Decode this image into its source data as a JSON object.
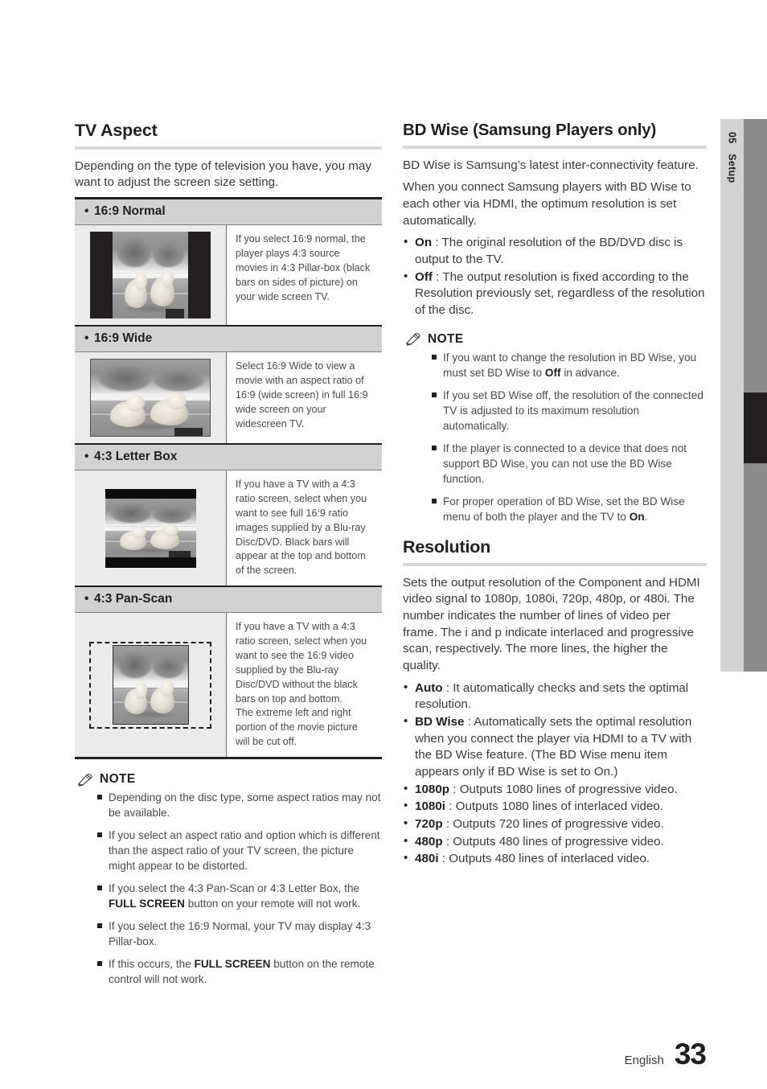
{
  "side_tab": {
    "chapter_number": "05",
    "chapter_label": "Setup"
  },
  "footer": {
    "language": "English",
    "page_number": "33"
  },
  "left_column": {
    "title": "TV Aspect",
    "intro": "Depending on the type of television you have, you may want to adjust the screen size setting.",
    "aspect_rows": [
      {
        "label": "16:9 Normal",
        "description": "If you select 16:9 normal, the player plays 4:3 source movies in 4:3 Pillar-box (black bars on sides of picture) on your wide screen TV.",
        "picture": "pillarbox-4-3-in-16-9-thumbnail"
      },
      {
        "label": "16:9 Wide",
        "description": "Select 16:9 Wide to view a movie with an aspect ratio of 16:9 (wide screen) in full 16:9 wide screen on your widescreen TV.",
        "picture": "full-16-9-widescreen-thumbnail"
      },
      {
        "label": "4:3 Letter Box",
        "description": "If you have a TV with a 4:3 ratio screen, select when you want to see full 16:9 ratio images supplied by a Blu-ray Disc/DVD. Black bars will appear at the top and bottom of the screen.",
        "picture": "letterbox-16-9-in-4-3-thumbnail"
      },
      {
        "label": "4:3 Pan-Scan",
        "description_parts": [
          "If you have a TV with a 4:3 ratio screen, select when you want to see the 16:9 video supplied by the Blu-ray Disc/DVD without the black bars on top and bottom.",
          "The extreme left and right portion of the movie picture will be cut off."
        ],
        "picture": "pan-scan-crop-thumbnail"
      }
    ],
    "note": {
      "label": "NOTE",
      "items": [
        [
          {
            "text": "Depending on the disc type, some aspect ratios may not be available.",
            "bold": false
          }
        ],
        [
          {
            "text": "If you select an aspect ratio and option which is different than the aspect ratio of your TV screen, the picture might appear to be distorted.",
            "bold": false
          }
        ],
        [
          {
            "text": "If you select the 4:3 Pan-Scan or 4:3 Letter Box, the ",
            "bold": false
          },
          {
            "text": "FULL SCREEN",
            "bold": true
          },
          {
            "text": " button on your remote will not work.",
            "bold": false
          }
        ],
        [
          {
            "text": "If you select the 16:9 Normal, your TV may display 4:3 Pillar-box.",
            "bold": false
          }
        ],
        [
          {
            "text": "If this occurs, the ",
            "bold": false
          },
          {
            "text": "FULL SCREEN",
            "bold": true
          },
          {
            "text": " button on the remote control will not work.",
            "bold": false
          }
        ]
      ]
    }
  },
  "right_column": {
    "bd_wise": {
      "title": "BD Wise (Samsung Players only)",
      "paragraphs": [
        "BD Wise is Samsung’s latest inter-connectivity feature.",
        "When you connect Samsung players with BD Wise to each other via HDMI, the optimum resolution is set automatically."
      ],
      "options": [
        {
          "term": "On",
          "desc": " : The original resolution of the BD/DVD disc is output to the TV."
        },
        {
          "term": "Off",
          "desc": " : The output resolution is fixed according to the Resolution previously set, regardless of the resolution of the disc."
        }
      ],
      "note": {
        "label": "NOTE",
        "items": [
          [
            {
              "text": "If you want to change the resolution in BD Wise, you must set BD Wise to ",
              "bold": false
            },
            {
              "text": "Off",
              "bold": true
            },
            {
              "text": " in advance.",
              "bold": false
            }
          ],
          [
            {
              "text": "If you set BD Wise off, the resolution of the connected TV is adjusted to its maximum resolution automatically.",
              "bold": false
            }
          ],
          [
            {
              "text": "If the player is connected to a device that does not support BD Wise, you can not use the BD Wise function.",
              "bold": false
            }
          ],
          [
            {
              "text": "For proper operation of BD Wise, set the BD Wise menu of both the player and the TV to ",
              "bold": false
            },
            {
              "text": "On",
              "bold": true
            },
            {
              "text": ".",
              "bold": false
            }
          ]
        ]
      }
    },
    "resolution": {
      "title": "Resolution",
      "paragraph": "Sets the output resolution of the Component and HDMI video signal to 1080p, 1080i, 720p, 480p, or 480i. The number indicates the number of lines of video per frame. The i and p indicate interlaced and progressive scan, respectively. The more lines, the higher the quality.",
      "options": [
        {
          "term": "Auto",
          "desc": " : It automatically checks and sets the optimal resolution."
        },
        {
          "term": "BD Wise",
          "desc": " : Automatically sets the optimal resolution when you connect the player via HDMI to a TV with the BD Wise feature. (The BD Wise menu item appears only if BD Wise is set to On.)"
        },
        {
          "term": "1080p",
          "desc": " : Outputs 1080 lines of progressive video."
        },
        {
          "term": "1080i",
          "desc": " : Outputs 1080 lines of interlaced video."
        },
        {
          "term": "720p",
          "desc": " : Outputs 720 lines of progressive video."
        },
        {
          "term": "480p",
          "desc": " : Outputs 480 lines of progressive video."
        },
        {
          "term": "480i",
          "desc": " : Outputs 480 lines of interlaced video."
        }
      ]
    }
  },
  "colors": {
    "text": "#231f20",
    "body_text": "#3b3b3b",
    "rule": "#d9d9d9",
    "table_header_bg": "#d2d2d2",
    "table_pic_bg": "#ebebeb",
    "side_tab_bg": "#d2d2d2",
    "side_bar_bg": "#8c8c8c",
    "side_marker_bg": "#231f20"
  }
}
